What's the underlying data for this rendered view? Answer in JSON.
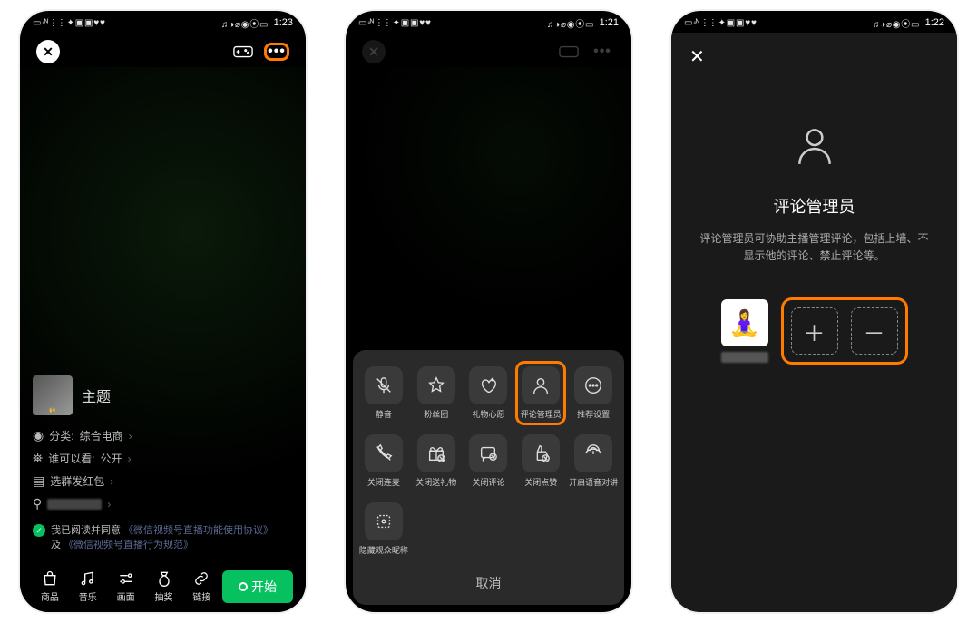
{
  "status": {
    "time1": "1:23",
    "time2": "1:21",
    "time3": "1:22"
  },
  "s1": {
    "theme_label": "主题",
    "cat_label": "分类:",
    "cat_value": "综合电商",
    "who_label": "谁可以看:",
    "who_value": "公开",
    "hongbao_label": "选群发红包",
    "agree_prefix": "我已阅读并同意",
    "agree_link1": "《微信视频号直播功能使用协议》",
    "agree_mid": "及",
    "agree_link2": "《微信视频号直播行为规范》",
    "tools": {
      "shop": "商品",
      "music": "音乐",
      "hua": "画面",
      "chou": "抽奖",
      "link": "链接"
    },
    "start": "开始"
  },
  "s2": {
    "items": [
      {
        "label": "静音",
        "icon": "mic-off"
      },
      {
        "label": "粉丝团",
        "icon": "star"
      },
      {
        "label": "礼物心愿",
        "icon": "heart"
      },
      {
        "label": "评论管理员",
        "icon": "person",
        "hl": true
      },
      {
        "label": "推荐设置",
        "icon": "more"
      },
      {
        "label": "关闭连麦",
        "icon": "phone-off"
      },
      {
        "label": "关闭送礼物",
        "icon": "gift-off"
      },
      {
        "label": "关闭评论",
        "icon": "comment-off"
      },
      {
        "label": "关闭点赞",
        "icon": "like-off"
      },
      {
        "label": "开启语音对讲",
        "icon": "voice"
      },
      {
        "label": "隐藏观众昵称",
        "icon": "hide"
      }
    ],
    "cancel": "取消"
  },
  "s3": {
    "title": "评论管理员",
    "desc": "评论管理员可协助主播管理评论，包括上墙、不显示他的评论、禁止评论等。"
  }
}
